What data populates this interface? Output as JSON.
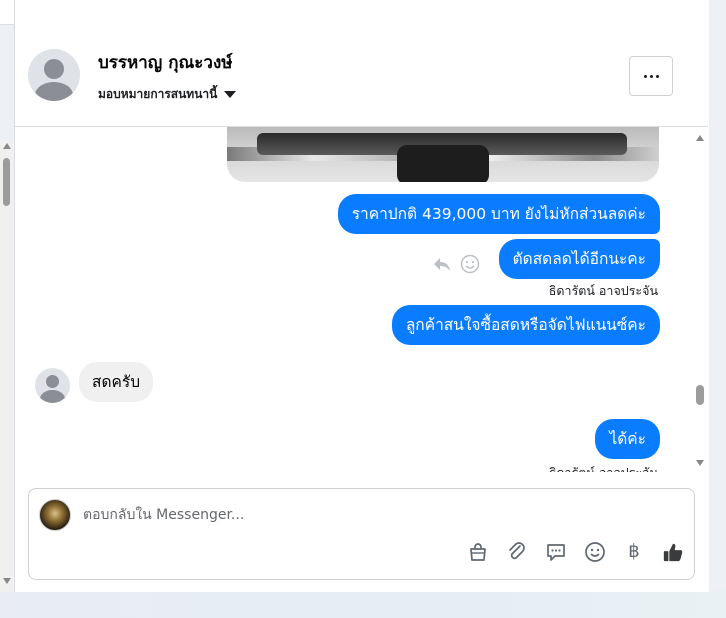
{
  "header": {
    "contact_name": "บรรหาญ กุณะวงษ์",
    "assign_label": "มอบหมายการสนทนานี้"
  },
  "messages": [
    {
      "direction": "out",
      "text": "ราคาปกติ 439,000 บาท ยังไม่หักส่วนลดค่ะ"
    },
    {
      "direction": "out",
      "text": "ตัดสดลดได้อีกนะคะ",
      "sender": "ธิดารัตน์ อาจประจัน"
    },
    {
      "direction": "out",
      "text": "ลูกค้าสนใจซื้อสดหรือจัดไฟแนนซ์คะ"
    },
    {
      "direction": "in",
      "text": "สดครับ"
    },
    {
      "direction": "out",
      "text": "ได้ค่ะ",
      "sender": "ธิดารัตน์ อาจประจัน"
    }
  ],
  "composer": {
    "placeholder": "ตอบกลับใน Messenger...",
    "tool_icons": [
      "shopping-bag-icon",
      "paperclip-icon",
      "chat-bubble-icon",
      "smiley-icon",
      "baht-icon",
      "thumbs-up-icon"
    ],
    "baht_symbol": "฿"
  },
  "colors": {
    "outgoing_bubble": "#0a7cff",
    "incoming_bubble": "#f0f0f0"
  }
}
